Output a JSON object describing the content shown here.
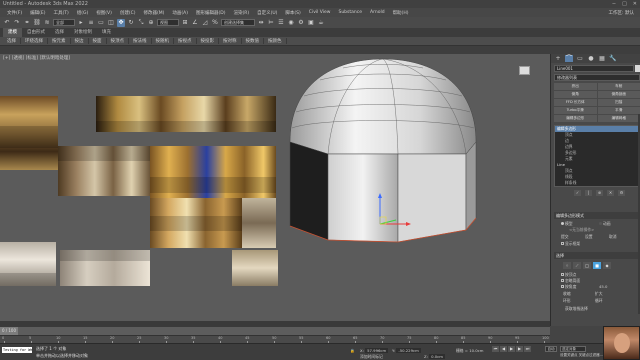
{
  "app": {
    "title": "Untitled - Autodesk 3ds Max 2022"
  },
  "window_controls": [
    "−",
    "□",
    "✕"
  ],
  "menus": [
    "文件(F)",
    "编辑(E)",
    "工具(T)",
    "组(G)",
    "视图(V)",
    "创建(C)",
    "修改器(M)",
    "动画(A)",
    "图形编辑器(D)",
    "渲染(R)",
    "自定义(U)",
    "脚本(S)",
    "Civil View",
    "Substance",
    "Arnold",
    "帮助(H)"
  ],
  "workspace": {
    "label": "工作区: 默认"
  },
  "toolbar": {
    "filter_select": "全部",
    "view_select": "视图",
    "named_selection": "创建选择集",
    "icons": [
      "undo-icon",
      "redo-icon",
      "link-icon",
      "unlink-icon",
      "bind-icon",
      "select-icon",
      "select-name-icon",
      "rect-select-icon",
      "window-icon",
      "move-icon",
      "rotate-icon",
      "scale-icon",
      "place-icon",
      "snap-icon",
      "angle-snap-icon",
      "mirror-icon",
      "align-icon",
      "layer-icon",
      "material-icon",
      "render-icon"
    ]
  },
  "ribbon_tabs": [
    {
      "label": "建模",
      "active": true
    },
    {
      "label": "自由形式",
      "active": false
    },
    {
      "label": "选择",
      "active": false
    },
    {
      "label": "对象绘制",
      "active": false
    },
    {
      "label": "填充",
      "active": false
    }
  ],
  "ribbon_items": [
    "选择",
    "环绕选择",
    "按元素",
    "按边",
    "按面",
    "按顶点",
    "按法线",
    "按随机",
    "按视点",
    "按投影",
    "按对称",
    "按数值",
    "按颜色"
  ],
  "viewport": {
    "label": "[+] [透视] [标准] [默认明暗处理]"
  },
  "timeline": {
    "frame_label": "0 / 100",
    "ticks": [
      "0",
      "5",
      "10",
      "15",
      "20",
      "25",
      "30",
      "35",
      "40",
      "45",
      "50",
      "55",
      "60",
      "65",
      "70",
      "75",
      "80",
      "85",
      "90",
      "95",
      "100"
    ]
  },
  "status": {
    "maxscript": "Testing for Wel",
    "selection": "选择了 1 个 对象",
    "hint": "单击并拖动以选择并移动对象",
    "x_label": "X:",
    "x_value": "57.996cm",
    "y_label": "Y:",
    "y_value": "-50.229cm",
    "z_label": "Z:",
    "z_value": "0.0cm",
    "grid_label": "栅格 = 10.0cm",
    "add_time_tag": "添加时间标记",
    "auto_key": "自动",
    "key_select": "选定对象",
    "set_key": "设置关键点 关键点过滤器...",
    "playback_icons": [
      "⏮",
      "◀",
      "▶",
      "▶",
      "⏭"
    ]
  },
  "command_panel": {
    "tab_icons": [
      "+",
      "⌒",
      "▭",
      "●",
      "▦",
      "🔧"
    ],
    "object_name": "Line001",
    "object_color": "#d8d8d8",
    "modifier_list": "修改器列表",
    "modifier_buttons": [
      "挤出",
      "车削",
      "倒角",
      "倒角剖面",
      "FFD 长方体",
      "扫描",
      "Turbo平滑",
      "平滑",
      "编辑多边形",
      "编辑网格"
    ],
    "stack": [
      {
        "label": "编辑多边形",
        "selected": true,
        "sub": false
      },
      {
        "label": "顶点",
        "selected": false,
        "sub": true
      },
      {
        "label": "边",
        "selected": false,
        "sub": true
      },
      {
        "label": "边界",
        "selected": false,
        "sub": true
      },
      {
        "label": "多边形",
        "selected": false,
        "sub": true
      },
      {
        "label": "元素",
        "selected": false,
        "sub": true
      },
      {
        "label": "Line",
        "selected": false,
        "sub": false
      },
      {
        "label": "顶点",
        "selected": false,
        "sub": true
      },
      {
        "label": "线段",
        "selected": false,
        "sub": true
      },
      {
        "label": "样条线",
        "selected": false,
        "sub": true
      }
    ],
    "stack_buttons": [
      "✓",
      "|",
      "⊕",
      "✕",
      "⚙"
    ],
    "rollout_mode": "编辑多边形模式",
    "mode_model": "模型",
    "mode_anim": "动画",
    "no_operation": "<无当前操作>",
    "commit_btn": "提交",
    "settings_btn": "设置",
    "cancel_btn": "取消",
    "show_cage": "显示框架",
    "rollout_select": "选择",
    "sel_by_vertex": "按顶点",
    "ignore_back": "忽略背面",
    "by_angle": "按角度",
    "by_angle_value": "45.0",
    "shrink": "收缩",
    "grow": "扩大",
    "ring": "环形",
    "loop": "循环",
    "get_stack_sel": "获取堆栈选择"
  },
  "colors": {
    "accent": "#5a7fa8",
    "active_blue": "#4aa3df",
    "gizmo_x": "#e83b3b",
    "gizmo_y": "#3bd33b",
    "gizmo_z": "#3b6bff"
  }
}
